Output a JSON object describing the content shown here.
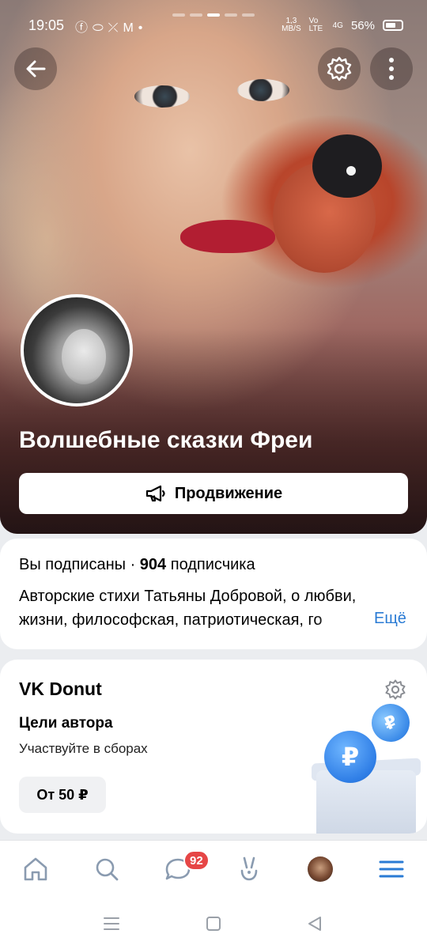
{
  "status_bar": {
    "time": "19:05",
    "net_speed": "1,3",
    "net_speed_unit": "MB/S",
    "carrier_a": "Vo LTE",
    "carrier_b": "4G",
    "battery": "56%"
  },
  "group": {
    "name": "Волшебные сказки Фреи",
    "promo_button": "Продвижение",
    "subscribed": "Вы подписаны",
    "separator": "·",
    "subscribers_count": "904",
    "subscribers_word": "подписчика",
    "description_line1": "Авторские стихи Татьяны Добровой, о любви,",
    "description_line2": "жизни,  философская, патриотическая, го",
    "more_link": "Ещё"
  },
  "donut": {
    "title": "VK Donut",
    "goals_title": "Цели автора",
    "goals_subtitle": "Участвуйте в сборах",
    "price_button": "От 50 ₽",
    "coin_symbol": "₽"
  },
  "bottom_nav": {
    "messages_badge": "92",
    "items": [
      "home-icon",
      "search-icon",
      "messages-icon",
      "clips-icon",
      "profile-avatar",
      "menu-icon"
    ]
  },
  "colors": {
    "accent": "#2a7bd4",
    "badge": "#e64646",
    "background": "#ebedf0"
  }
}
